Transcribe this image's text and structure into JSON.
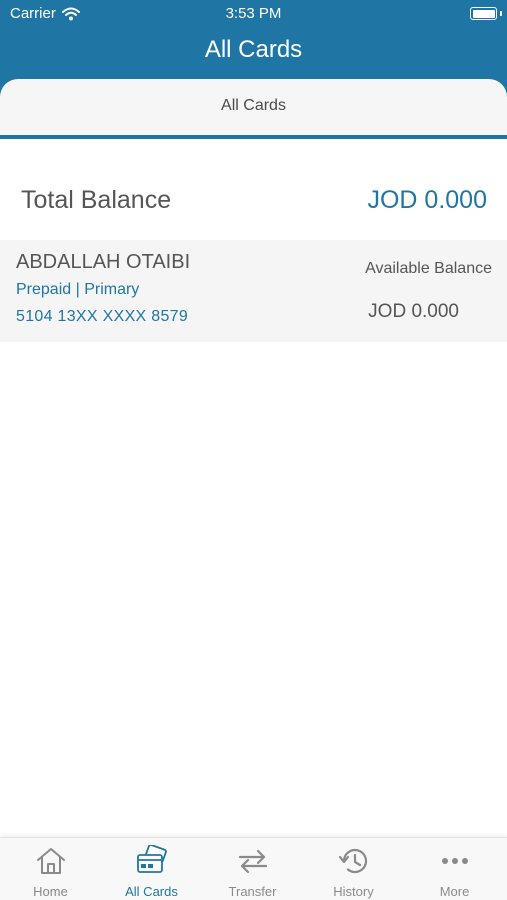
{
  "status_bar": {
    "carrier": "Carrier",
    "time": "3:53 PM"
  },
  "header": {
    "title": "All Cards"
  },
  "segment": {
    "label": "All Cards"
  },
  "summary": {
    "label": "Total Balance",
    "value": "JOD 0.000"
  },
  "cards": [
    {
      "holder": "ABDALLAH OTAIBI",
      "type": "Prepaid | Primary",
      "number": "5104 13XX XXXX 8579",
      "balance_label": "Available Balance",
      "balance": "JOD 0.000"
    }
  ],
  "tabbar": {
    "items": [
      {
        "label": "Home",
        "icon": "home-icon"
      },
      {
        "label": "All Cards",
        "icon": "cards-icon",
        "active": true
      },
      {
        "label": "Transfer",
        "icon": "transfer-icon"
      },
      {
        "label": "History",
        "icon": "history-icon"
      },
      {
        "label": "More",
        "icon": "more-icon"
      }
    ]
  },
  "colors": {
    "brand": "#1f76a4",
    "text": "#555555",
    "inactive": "#8a8a8a"
  }
}
